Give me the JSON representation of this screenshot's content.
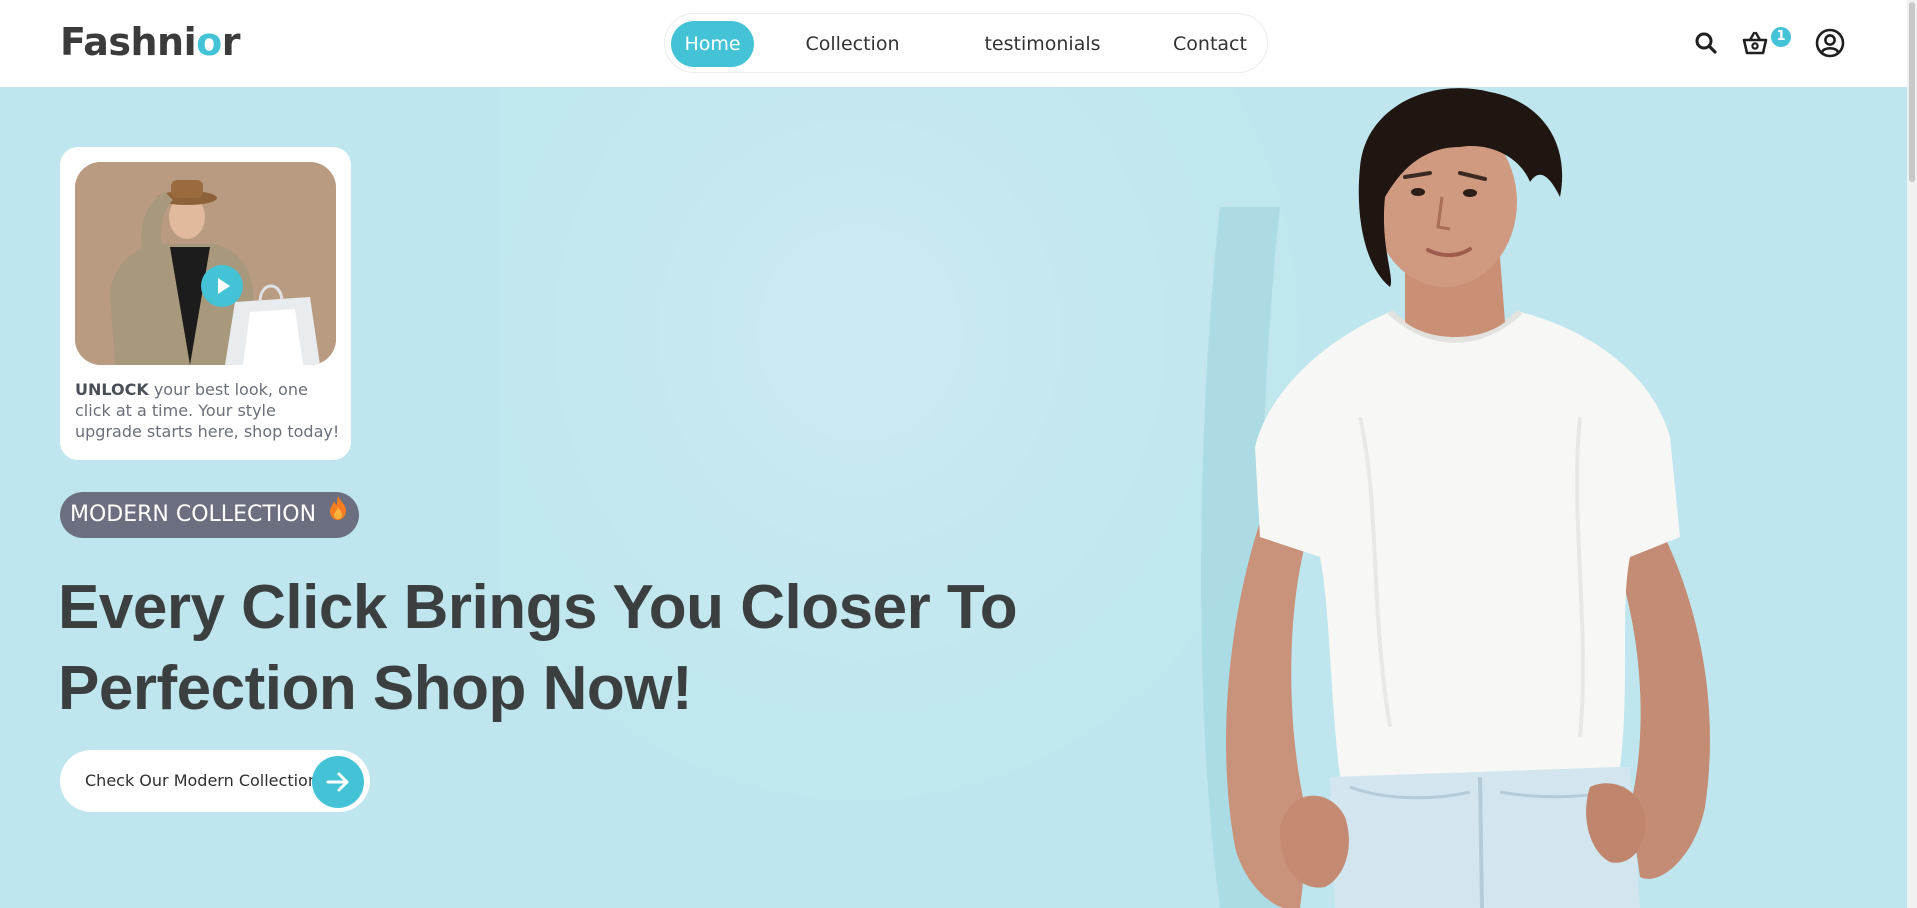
{
  "brand": {
    "name_main": "Fashni",
    "name_accent": "o",
    "name_tail": "r",
    "accent_color": "#45c3d6"
  },
  "nav": {
    "items": [
      {
        "label": "Home",
        "active": true
      },
      {
        "label": "Collection",
        "active": false
      },
      {
        "label": "testimonials",
        "active": false
      },
      {
        "label": "Contact",
        "active": false
      }
    ]
  },
  "header_icons": {
    "search": "search-icon",
    "cart": "basket-icon",
    "account": "user-circle-icon",
    "cart_count": "1"
  },
  "video_card": {
    "play_icon": "play-icon",
    "text_strong": "UNLOCK",
    "text_rest": " your best look, one click at a time. Your style upgrade starts here, shop today!"
  },
  "hero": {
    "badge": "MODERN COLLECTION",
    "badge_icon": "fire-icon",
    "headline_line1": "Every Click Brings You Closer To",
    "headline_line2": "Perfection Shop Now!",
    "cta_label": "Check Our Modern Collection",
    "cta_icon": "arrow-right-icon",
    "background_color": "#bfe6ee"
  }
}
